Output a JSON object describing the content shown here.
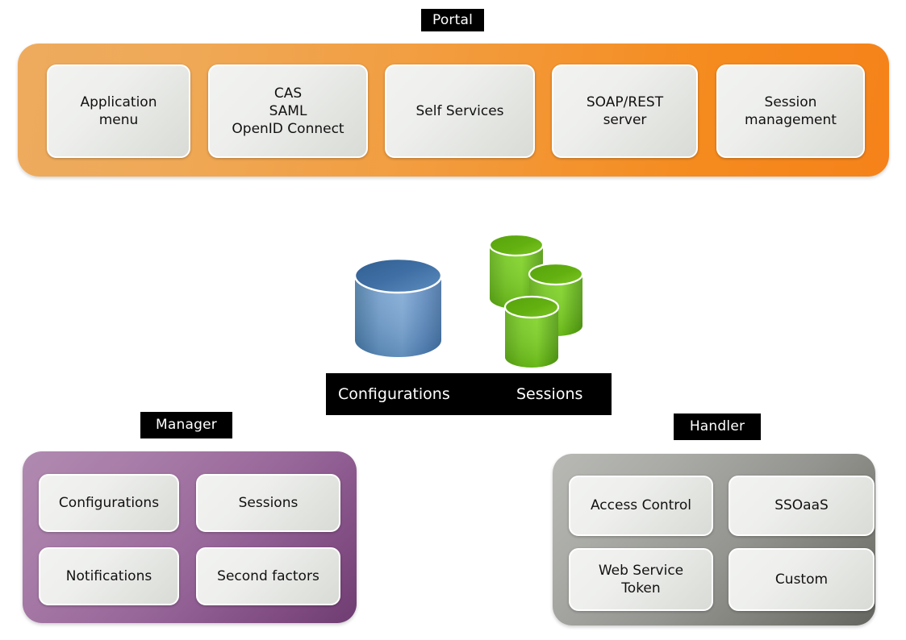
{
  "diagram": {
    "title_labels": {
      "portal": "Portal",
      "manager": "Manager",
      "handler": "Handler"
    },
    "portal": {
      "accent_color": "#f5821a",
      "boxes": [
        {
          "id": "application-menu",
          "label": "Application\nmenu"
        },
        {
          "id": "protocols",
          "label": "CAS\nSAML\nOpenID Connect"
        },
        {
          "id": "self-services",
          "label": "Self Services"
        },
        {
          "id": "soap-rest-server",
          "label": "SOAP/REST\nserver"
        },
        {
          "id": "session-management",
          "label": "Session\nmanagement"
        }
      ]
    },
    "storage": {
      "caption_bar_color": "#000000",
      "items": [
        {
          "id": "configurations",
          "label": "Configurations",
          "icon": "database-cylinder-icon",
          "color": "#4a7ebb",
          "count": 1
        },
        {
          "id": "sessions",
          "label": "Sessions",
          "icon": "database-cylinder-cluster-icon",
          "color": "#6ebe11",
          "count": 3
        }
      ]
    },
    "manager": {
      "accent_color": "#8e5f91",
      "boxes": [
        {
          "id": "configurations",
          "label": "Configurations"
        },
        {
          "id": "sessions",
          "label": "Sessions"
        },
        {
          "id": "notifications",
          "label": "Notifications"
        },
        {
          "id": "second-factors",
          "label": "Second factors"
        }
      ]
    },
    "handler": {
      "accent_color": "#8d8e88",
      "boxes": [
        {
          "id": "access-control",
          "label": "Access Control"
        },
        {
          "id": "ssoaas",
          "label": "SSOaaS"
        },
        {
          "id": "web-service-token",
          "label": "Web Service\nToken"
        },
        {
          "id": "custom",
          "label": "Custom"
        }
      ]
    }
  }
}
